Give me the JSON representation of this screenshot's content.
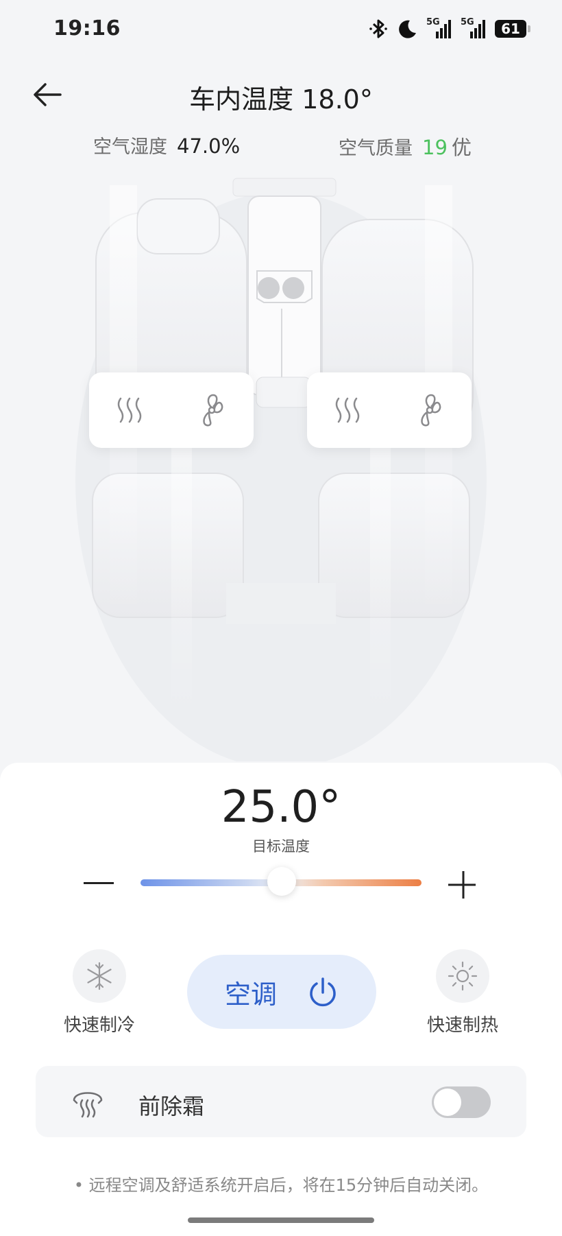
{
  "status_bar": {
    "time": "19:16",
    "network_1": "5G",
    "network_2": "5G",
    "battery": "61",
    "icons": [
      "bluetooth-icon",
      "moon-icon",
      "signal-icon",
      "signal-icon",
      "battery-icon"
    ]
  },
  "header": {
    "title": "车内温度 18.0°",
    "humidity_label": "空气湿度",
    "humidity_value": "47.0%",
    "air_quality_label": "空气质量",
    "air_quality_value": "19",
    "air_quality_grade": "优"
  },
  "seats": {
    "left_icons": [
      "seat-heat-icon",
      "fan-icon"
    ],
    "right_icons": [
      "seat-heat-icon",
      "fan-icon"
    ]
  },
  "climate": {
    "target_temp": "25.0°",
    "target_label": "目标温度",
    "slider_level": 0.5,
    "quick_cool_label": "快速制冷",
    "ac_label": "空调",
    "quick_heat_label": "快速制热",
    "defrost_label": "前除霜",
    "defrost_on": false,
    "notice": "• 远程空调及舒适系统开启后，将在15分钟后自动关闭。"
  },
  "colors": {
    "accent_blue": "#2d5fc9",
    "ac_button_bg": "#e5edfb",
    "air_quality_good": "#4cc15e",
    "slider_cold": "#6e93e8",
    "slider_hot": "#ec7f45"
  }
}
